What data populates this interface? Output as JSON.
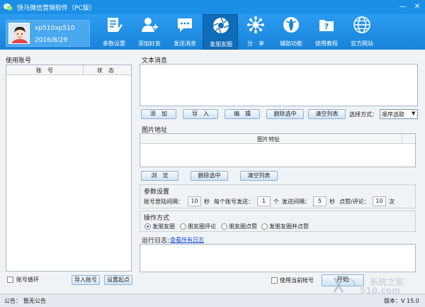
{
  "window": {
    "title": "快马微信营销软件（PC版）",
    "min_symbol": "—",
    "close_symbol": "✕"
  },
  "profile": {
    "name": "xp510xp510",
    "date": "2016/8/29"
  },
  "toolbar": [
    {
      "label": "参数设置",
      "icon": "document-edit-icon"
    },
    {
      "label": "添加好友",
      "icon": "add-user-icon"
    },
    {
      "label": "发送消息",
      "icon": "chat-bubble-icon"
    },
    {
      "label": "发朋友圈",
      "icon": "aperture-icon",
      "active": true
    },
    {
      "label": "分　享",
      "icon": "share-network-icon"
    },
    {
      "label": "辅助功能",
      "icon": "helper-icon"
    },
    {
      "label": "使用教程",
      "icon": "tutorial-folder-icon"
    },
    {
      "label": "官方网站",
      "icon": "globe-icon"
    }
  ],
  "accounts": {
    "label": "使用账号",
    "col_account": "账　号",
    "col_status": "状　态",
    "loop_label": "账号循环",
    "import_btn": "导入账号",
    "set_start_btn": "设置起点"
  },
  "text_msg": {
    "label": "文本消息",
    "add_btn": "添　加",
    "import_btn": "导　入",
    "edit_btn": "编　辑",
    "delete_btn": "删除选中",
    "clear_btn": "清空列表",
    "select_mode_label": "选择方式：",
    "select_mode_value": "顺序选取"
  },
  "images": {
    "label": "图片地址",
    "col_header": "图片地址",
    "browse_btn": "浏　览",
    "delete_btn": "删除选中",
    "clear_btn": "清空列表"
  },
  "params": {
    "label": "参数设置",
    "login_interval_label": "账号登陆间隔：",
    "login_interval_value": "10",
    "sec1": "秒",
    "per_account_label": "每个账号发送：",
    "per_account_value": "1",
    "count_unit": "个",
    "send_interval_label": "发送间隔：",
    "send_interval_value": "5",
    "sec2": "秒",
    "like_comment_label": "点赞/评论：",
    "like_comment_value": "10",
    "times_unit": "次"
  },
  "operation": {
    "label": "操作方式",
    "options": [
      "发朋友圈",
      "朋友圈评论",
      "朋友圈点赞",
      "发朋友圈并点赞"
    ],
    "selected": 0
  },
  "log": {
    "label": "运行日志:",
    "view_all_link": "查看所有日志"
  },
  "bottom": {
    "use_current_label": "使用当前帐号",
    "start_btn": "开始"
  },
  "status": {
    "notice_label": "公告：",
    "notice_text": "暂无公告",
    "version": "版本：V 15.0"
  },
  "watermark": {
    "text": "系统之家",
    "sub": "510.com"
  },
  "colors": {
    "titlebar": "#1b8fe6",
    "toolbar": "#1883d8",
    "active_tool": "#0f6cb8",
    "link": "#1a4fd6"
  }
}
